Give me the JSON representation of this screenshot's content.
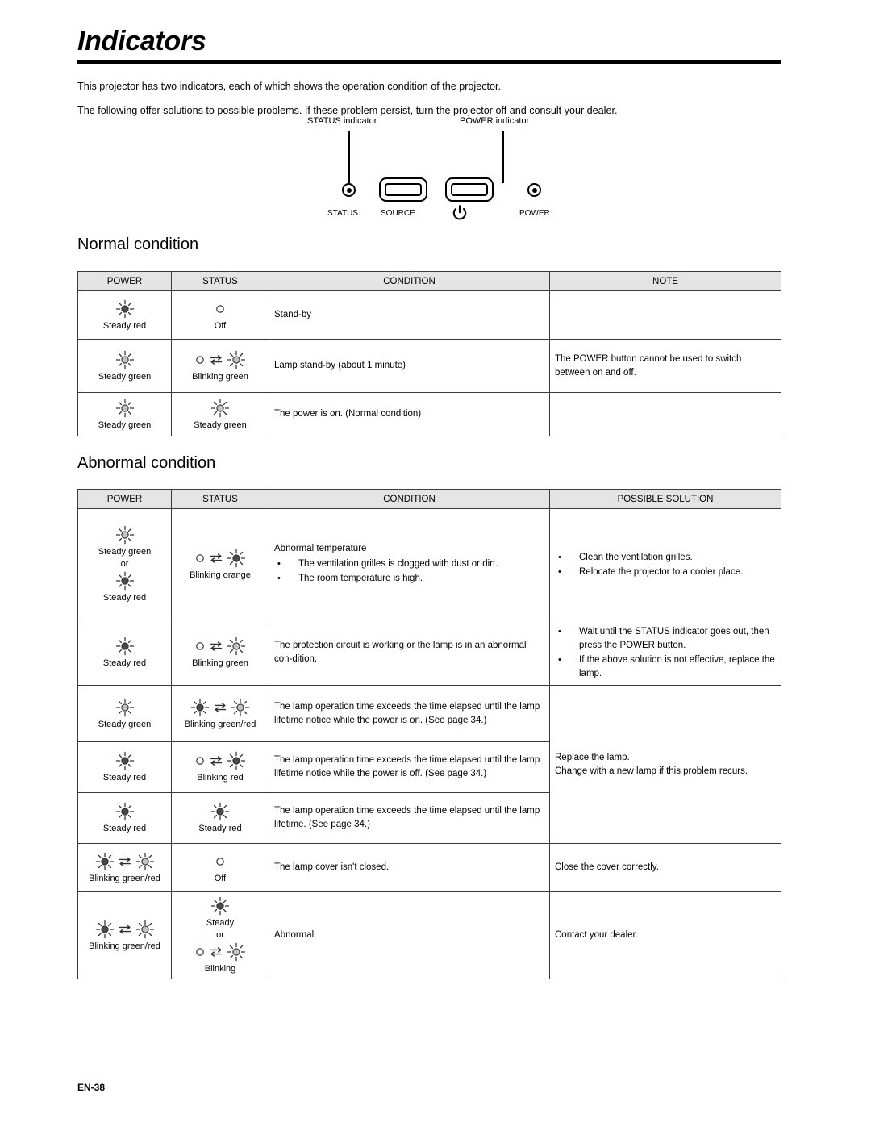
{
  "document": {
    "title": "Indicators",
    "footer_page": "EN-38"
  },
  "intro": {
    "line1": "This projector has two indicators, each of which shows the operation condition of the projector.",
    "line2": "The following offer solutions to possible problems. If these problem persist, turn the projector off and consult your dealer."
  },
  "panel_figure": {
    "status_callout": "STATUS indicator",
    "power_callout": "POWER indicator",
    "status_caption": "STATUS",
    "source_caption": "SOURCE",
    "power_caption": "POWER",
    "power_button_icon": "power-symbol-icon",
    "status_led_icon": "status-led-icon",
    "power_led_icon": "power-led-icon"
  },
  "sections": {
    "normal": {
      "heading": "Normal condition",
      "columns": [
        "POWER",
        "STATUS",
        "CONDITION",
        "NOTE"
      ],
      "rows": [
        {
          "power": {
            "icons": [
              {
                "type": "steady",
                "fill": "dark"
              }
            ],
            "label": "Steady red"
          },
          "status": {
            "icons": [
              {
                "type": "off"
              }
            ],
            "label": "Off"
          },
          "condition": "Stand-by",
          "condition_bullets": [],
          "note": "",
          "note_bullets": []
        },
        {
          "power": {
            "icons": [
              {
                "type": "steady",
                "fill": "light"
              }
            ],
            "label": "Steady green"
          },
          "status": {
            "icons": [
              {
                "type": "off"
              },
              {
                "type": "arrows"
              },
              {
                "type": "steady",
                "fill": "light"
              }
            ],
            "label": "Blinking green"
          },
          "condition": "Lamp stand-by (about 1 minute)",
          "condition_bullets": [],
          "note": "The POWER button cannot be used to switch between on and off.",
          "note_bullets": []
        },
        {
          "power": {
            "icons": [
              {
                "type": "steady",
                "fill": "light"
              }
            ],
            "label": "Steady green"
          },
          "status": {
            "icons": [
              {
                "type": "steady",
                "fill": "light"
              }
            ],
            "label": "Steady green"
          },
          "condition": "The power is on. (Normal condition)",
          "condition_bullets": [],
          "note": "",
          "note_bullets": []
        }
      ]
    },
    "abnormal": {
      "heading": "Abnormal condition",
      "columns": [
        "POWER",
        "STATUS",
        "CONDITION",
        "POSSIBLE SOLUTION"
      ],
      "rows": [
        {
          "power_stack": [
            {
              "icons": [
                {
                  "type": "steady",
                  "fill": "light"
                }
              ],
              "label": "Steady green"
            },
            {
              "separator": "or"
            },
            {
              "icons": [
                {
                  "type": "steady",
                  "fill": "dark"
                }
              ],
              "label": "Steady red"
            }
          ],
          "status": {
            "icons": [
              {
                "type": "off"
              },
              {
                "type": "arrows"
              },
              {
                "type": "steady",
                "fill": "dark"
              }
            ],
            "label": "Blinking orange"
          },
          "condition": "Abnormal temperature",
          "condition_bullets": [
            "The ventilation grilles is clogged with dust or dirt.",
            "The room temperature is high."
          ],
          "note": "",
          "note_bullets": [
            "Clean the ventilation grilles.",
            "Relocate the projector to a cooler place."
          ]
        },
        {
          "power": {
            "icons": [
              {
                "type": "steady",
                "fill": "dark"
              }
            ],
            "label": "Steady red"
          },
          "status": {
            "icons": [
              {
                "type": "off"
              },
              {
                "type": "arrows"
              },
              {
                "type": "steady",
                "fill": "light"
              }
            ],
            "label": "Blinking green"
          },
          "condition": "The protection circuit is working or the lamp is in an abnormal con-dition.",
          "condition_bullets": [],
          "note": "",
          "note_bullets": [
            "Wait until the STATUS indicator goes out, then press the POWER button.",
            "If the above solution is not effective, replace the lamp."
          ]
        },
        {
          "power": {
            "icons": [
              {
                "type": "steady",
                "fill": "light"
              }
            ],
            "label": "Steady green"
          },
          "status": {
            "icons": [
              {
                "type": "steady",
                "fill": "dark"
              },
              {
                "type": "arrows"
              },
              {
                "type": "steady",
                "fill": "light"
              }
            ],
            "label": "Blinking green/red"
          },
          "condition": "The lamp operation time exceeds the time elapsed until the lamp lifetime notice while the power is on. (See page 34.)",
          "condition_bullets": [],
          "note": "",
          "note_bullets": []
        },
        {
          "power": {
            "icons": [
              {
                "type": "steady",
                "fill": "dark"
              }
            ],
            "label": "Steady red"
          },
          "status": {
            "icons": [
              {
                "type": "off"
              },
              {
                "type": "arrows"
              },
              {
                "type": "steady",
                "fill": "dark"
              }
            ],
            "label": "Blinking red"
          },
          "condition": "The lamp operation time exceeds the time elapsed until the lamp lifetime notice while the power is off. (See page 34.)",
          "condition_bullets": [],
          "note": "Replace the lamp.\nChange with a new lamp if this problem recurs.",
          "note_bullets": []
        },
        {
          "power": {
            "icons": [
              {
                "type": "steady",
                "fill": "dark"
              }
            ],
            "label": "Steady red"
          },
          "status": {
            "icons": [
              {
                "type": "steady",
                "fill": "dark"
              }
            ],
            "label": "Steady red"
          },
          "condition": "The lamp operation time exceeds the time elapsed until the lamp lifetime. (See page 34.)",
          "condition_bullets": [],
          "note": "",
          "note_bullets": []
        },
        {
          "power": {
            "icons": [
              {
                "type": "steady",
                "fill": "dark"
              },
              {
                "type": "arrows"
              },
              {
                "type": "steady",
                "fill": "light"
              }
            ],
            "label": "Blinking green/red"
          },
          "status": {
            "icons": [
              {
                "type": "off"
              }
            ],
            "label": "Off"
          },
          "condition": "The lamp cover isn't closed.",
          "condition_bullets": [],
          "note": "Close the cover correctly.",
          "note_bullets": []
        },
        {
          "power": {
            "icons": [
              {
                "type": "steady",
                "fill": "dark"
              },
              {
                "type": "arrows"
              },
              {
                "type": "steady",
                "fill": "light"
              }
            ],
            "label": "Blinking green/red"
          },
          "status_stack": [
            {
              "icons": [
                {
                  "type": "steady",
                  "fill": "dark"
                }
              ],
              "label": "Steady"
            },
            {
              "separator": "or"
            },
            {
              "icons": [
                {
                  "type": "off"
                },
                {
                  "type": "arrows"
                },
                {
                  "type": "steady",
                  "fill": "light"
                }
              ],
              "label": "Blinking"
            }
          ],
          "condition": "Abnormal.",
          "condition_bullets": [],
          "note": "Contact your dealer.",
          "note_bullets": []
        }
      ]
    }
  },
  "colors": {
    "header_bg": "#e4e4e4",
    "border": "#3a3a3a",
    "icon_dark": "#4a4a4a",
    "icon_light": "#c4c4c4",
    "text": "#000000"
  }
}
